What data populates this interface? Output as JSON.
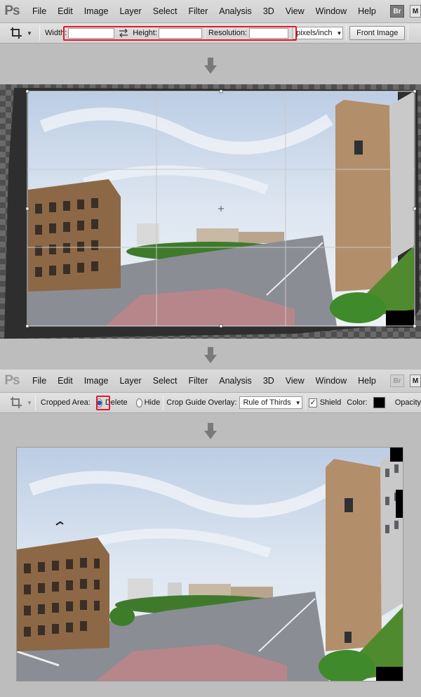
{
  "app": {
    "logo": "Ps",
    "bridge_label": "Br",
    "minibridge_label": "M"
  },
  "menu": [
    "File",
    "Edit",
    "Image",
    "Layer",
    "Select",
    "Filter",
    "Analysis",
    "3D",
    "View",
    "Window",
    "Help"
  ],
  "options_before": {
    "width_label": "Width:",
    "width_value": "",
    "height_label": "Height:",
    "height_value": "",
    "resolution_label": "Resolution:",
    "resolution_value": "",
    "units": "pixels/inch",
    "front_image_label": "Front Image"
  },
  "options_after": {
    "cropped_area_label": "Cropped Area:",
    "delete_label": "Delete",
    "hide_label": "Hide",
    "selected": "Delete",
    "overlay_label": "Crop Guide Overlay:",
    "overlay_value": "Rule of Thirds",
    "shield_label": "Shield",
    "shield_checked": true,
    "color_label": "Color:",
    "shield_color": "#000000",
    "opacity_label": "Opacity"
  },
  "colors": {
    "highlight": "#e0192a",
    "step_arrow": "#7a7a7a"
  },
  "icons": [
    "crop-icon",
    "swap-icon",
    "chevron-down-icon",
    "down-arrow-icon",
    "radio-icon",
    "checkbox-icon"
  ]
}
